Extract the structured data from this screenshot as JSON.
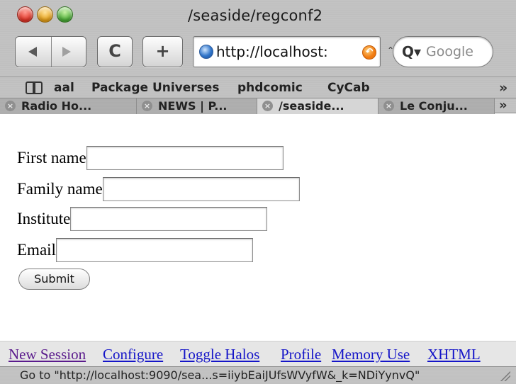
{
  "window": {
    "title": "/seaside/regconf2"
  },
  "toolbar": {
    "reload_glyph": "C",
    "add_glyph": "+",
    "url": "http://localhost:",
    "search_placeholder": "Google"
  },
  "bookmarks": [
    "aal",
    "Package Universes",
    "phdcomic",
    "CyCab"
  ],
  "overflow_glyph": "»",
  "tabs": [
    {
      "label": "Radio Ho...",
      "active": false
    },
    {
      "label": "NEWS | P...",
      "active": false
    },
    {
      "label": "/seaside...",
      "active": true
    },
    {
      "label": "Le Conju...",
      "active": false
    }
  ],
  "form": {
    "fields": [
      {
        "label": "First name",
        "value": ""
      },
      {
        "label": "Family name",
        "value": ""
      },
      {
        "label": "Institute",
        "value": ""
      },
      {
        "label": "Email",
        "value": ""
      }
    ],
    "submit_label": "Submit"
  },
  "links": [
    "New Session",
    "Configure",
    "Toggle Halos",
    "Profile",
    "Memory Use",
    "XHTML"
  ],
  "status": {
    "text": "Go to \"http://localhost:9090/sea...s=iiybEaiJUfsWVyfW&_k=NDiYynvQ\""
  }
}
